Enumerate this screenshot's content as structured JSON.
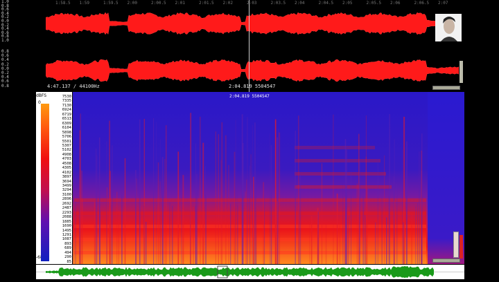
{
  "waveform": {
    "amp_labels_top": [
      "1.0",
      "0.8",
      "0.6",
      "0.4",
      "0.2",
      "0.0",
      "0.2",
      "0.4",
      "0.6",
      "0.8",
      "1.0"
    ],
    "amp_labels_bottom": [
      "0.8",
      "0.6",
      "0.4",
      "0.2",
      "0.0",
      "0.2",
      "0.4",
      "0.6",
      "0.8"
    ],
    "time_ticks": [
      "1:58.5",
      "1:59",
      "1:59.5",
      "2:00",
      "2:00.5",
      "2:01",
      "2:01.5",
      "2:02",
      "2:03",
      "2:03.5",
      "2:04",
      "2:04.5",
      "2:05",
      "2:05.5",
      "2:06",
      "2:06.5",
      "2:07"
    ],
    "info_left": "4:47.137 / 44100Hz",
    "info_cursor": "2:04.819  5504547",
    "color": "#ff1a1a"
  },
  "spectrogram": {
    "dbfs_label": "dBFS",
    "dbfs_top": "0",
    "dbfs_bottom": "-68",
    "cursor_info": "2:04.819  5504547",
    "freq_labels": [
      "7530",
      "7335",
      "7130",
      "6924",
      "6719",
      "6513",
      "6309",
      "6104",
      "5898",
      "5706",
      "5501",
      "5307",
      "5102",
      "4908",
      "4703",
      "4508",
      "4305",
      "4102",
      "3897",
      "3694",
      "3499",
      "3294",
      "3100",
      "2896",
      "2692",
      "2487",
      "2293",
      "2088",
      "1885",
      "1690",
      "1495",
      "1291",
      "1087",
      "893",
      "689",
      "494",
      "290",
      "85"
    ]
  },
  "overview": {
    "waveform_color": "#1a9a1a"
  },
  "thumbnail": {
    "icon": "portrait-icon"
  }
}
